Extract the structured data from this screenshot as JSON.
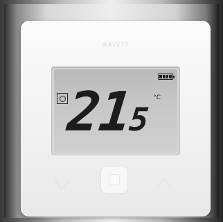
{
  "device": {
    "brand_label": "WAVETY",
    "display": {
      "temperature_integer": "21",
      "temperature_decimal": "5",
      "unit": "°C",
      "battery_bars": 4
    },
    "buttons": {
      "down": "down-chevron",
      "center": "select",
      "up": "up-chevron"
    }
  }
}
